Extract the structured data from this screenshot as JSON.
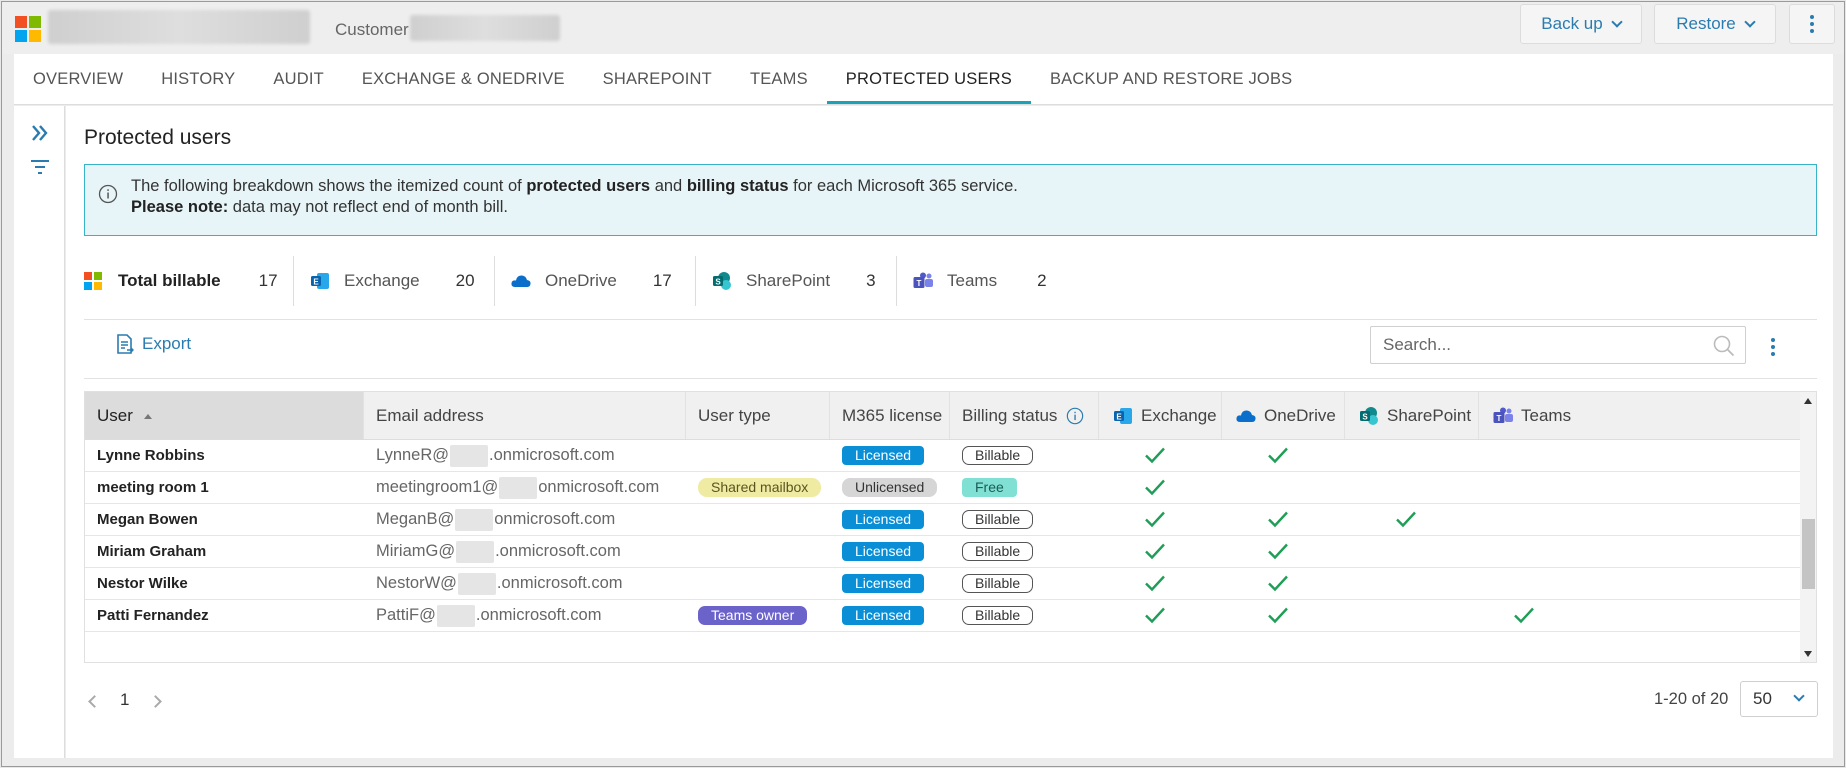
{
  "header": {
    "customer_label": "Customer",
    "backup_label": "Back up",
    "restore_label": "Restore"
  },
  "tabs": [
    {
      "label": "OVERVIEW",
      "active": false
    },
    {
      "label": "HISTORY",
      "active": false
    },
    {
      "label": "AUDIT",
      "active": false
    },
    {
      "label": "EXCHANGE & ONEDRIVE",
      "active": false
    },
    {
      "label": "SHAREPOINT",
      "active": false
    },
    {
      "label": "TEAMS",
      "active": false
    },
    {
      "label": "PROTECTED USERS",
      "active": true
    },
    {
      "label": "BACKUP AND RESTORE JOBS",
      "active": false
    }
  ],
  "page": {
    "title": "Protected users",
    "info": {
      "line1_pre": "The following breakdown shows the itemized count of ",
      "line1_b1": "protected users",
      "line1_mid": " and ",
      "line1_b2": "billing status",
      "line1_post": " for each Microsoft 365 service.",
      "line2_b": "Please note:",
      "line2_post": " data may not reflect end of month bill."
    }
  },
  "stats": {
    "total": {
      "label": "Total billable",
      "value": "17"
    },
    "exchange": {
      "label": "Exchange",
      "value": "20"
    },
    "onedrive": {
      "label": "OneDrive",
      "value": "17"
    },
    "sharepoint": {
      "label": "SharePoint",
      "value": "3"
    },
    "teams": {
      "label": "Teams",
      "value": "2"
    }
  },
  "toolbar": {
    "export_label": "Export",
    "search_placeholder": "Search..."
  },
  "table": {
    "columns": {
      "user": "User",
      "email": "Email address",
      "user_type": "User type",
      "license": "M365 license",
      "billing": "Billing status",
      "exchange": "Exchange",
      "onedrive": "OneDrive",
      "sharepoint": "SharePoint",
      "teams": "Teams"
    },
    "rows": [
      {
        "user": "Lynne Robbins",
        "email_pre": "LynneR@",
        "email_post": ".onmicrosoft.com",
        "user_type": "",
        "license": "Licensed",
        "billing": "Billable",
        "exchange": true,
        "onedrive": true,
        "sharepoint": false,
        "teams": false
      },
      {
        "user": "meeting room 1",
        "email_pre": "meetingroom1@",
        "email_post": "onmicrosoft.com",
        "user_type": "Shared mailbox",
        "license": "Unlicensed",
        "billing": "Free",
        "exchange": true,
        "onedrive": false,
        "sharepoint": false,
        "teams": false
      },
      {
        "user": "Megan Bowen",
        "email_pre": "MeganB@",
        "email_post": "onmicrosoft.com",
        "user_type": "",
        "license": "Licensed",
        "billing": "Billable",
        "exchange": true,
        "onedrive": true,
        "sharepoint": true,
        "teams": false
      },
      {
        "user": "Miriam Graham",
        "email_pre": "MiriamG@",
        "email_post": ".onmicrosoft.com",
        "user_type": "",
        "license": "Licensed",
        "billing": "Billable",
        "exchange": true,
        "onedrive": true,
        "sharepoint": false,
        "teams": false
      },
      {
        "user": "Nestor Wilke",
        "email_pre": "NestorW@",
        "email_post": ".onmicrosoft.com",
        "user_type": "",
        "license": "Licensed",
        "billing": "Billable",
        "exchange": true,
        "onedrive": true,
        "sharepoint": false,
        "teams": false
      },
      {
        "user": "Patti Fernandez",
        "email_pre": "PattiF@",
        "email_post": ".onmicrosoft.com",
        "user_type": "Teams owner",
        "license": "Licensed",
        "billing": "Billable",
        "exchange": true,
        "onedrive": true,
        "sharepoint": false,
        "teams": true
      }
    ]
  },
  "pagination": {
    "current_page": "1",
    "range": "1-20 of 20",
    "page_size": "50"
  },
  "colors": {
    "accent": "#1aa3b8",
    "link": "#2a7cb0",
    "check": "#1e9e57",
    "licensed": "#0a8fd6"
  }
}
